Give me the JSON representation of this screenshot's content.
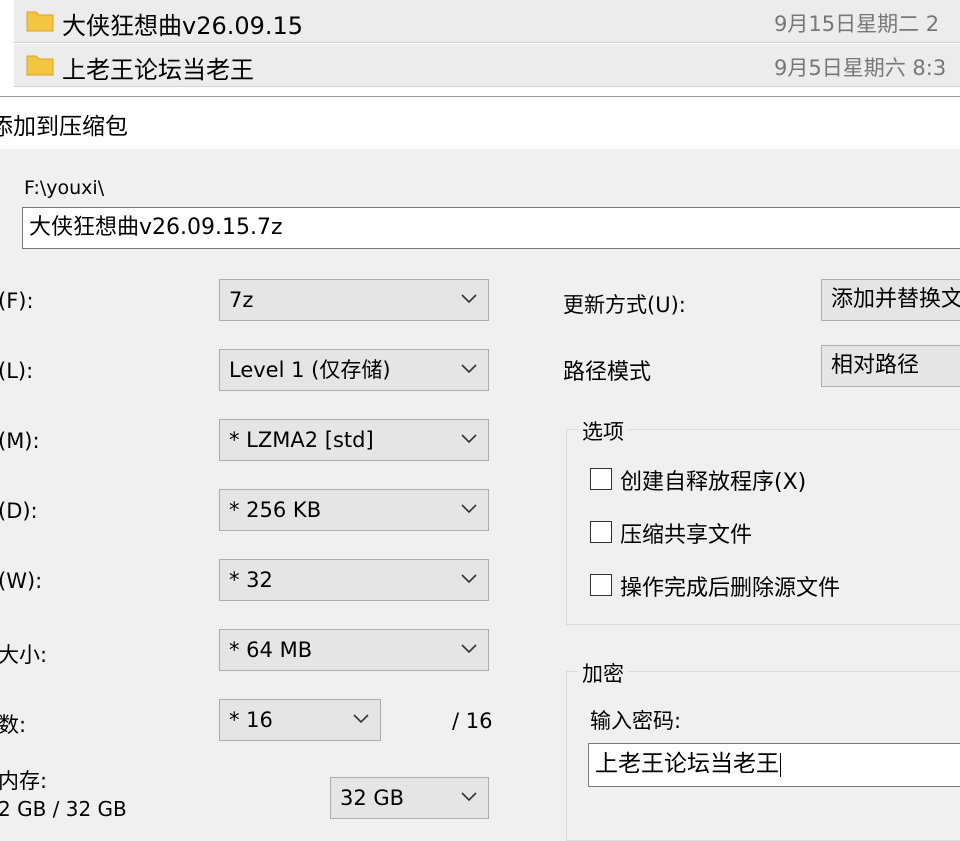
{
  "explorer": {
    "rows": [
      {
        "name": "大侠狂想曲v26.09.15",
        "date": "9月15日星期二 2"
      },
      {
        "name": "上老王论坛当老王",
        "date": "9月5日星期六 8:3"
      }
    ]
  },
  "dialog": {
    "title": "添加到压缩包",
    "path_label": "F:\\youxi\\",
    "archive_name": "大侠狂想曲v26.09.15.7z",
    "left": {
      "format": {
        "label": "(F):",
        "value": "7z"
      },
      "level": {
        "label": "(L):",
        "value": "Level 1 (仅存储)"
      },
      "method": {
        "label": "(M):",
        "value": "* LZMA2 [std]"
      },
      "dictionary": {
        "label": "(D):",
        "value": "* 256 KB"
      },
      "word": {
        "label": "(W):",
        "value": "* 32"
      },
      "solid": {
        "label": "大小:",
        "value": "* 64 MB"
      },
      "threads": {
        "label": "数:",
        "value": "* 16",
        "max": "/ 16"
      },
      "memory": {
        "label": "内存:",
        "usage": "2 GB / 32 GB",
        "value": "32 GB"
      }
    },
    "right": {
      "update": {
        "label": "更新方式(U):",
        "value": "添加并替换文"
      },
      "pathmode": {
        "label": "路径模式",
        "value": "相对路径"
      },
      "options": {
        "title": "选项",
        "items": [
          "创建自释放程序(X)",
          "压缩共享文件",
          "操作完成后删除源文件"
        ]
      },
      "encryption": {
        "title": "加密",
        "password_label": "输入密码:",
        "password_value": "上老王论坛当老王"
      }
    },
    "colors": {
      "folder": "#f4c542",
      "field_bg": "#e5e5e5",
      "dialog_bg": "#f0f0f0"
    }
  }
}
